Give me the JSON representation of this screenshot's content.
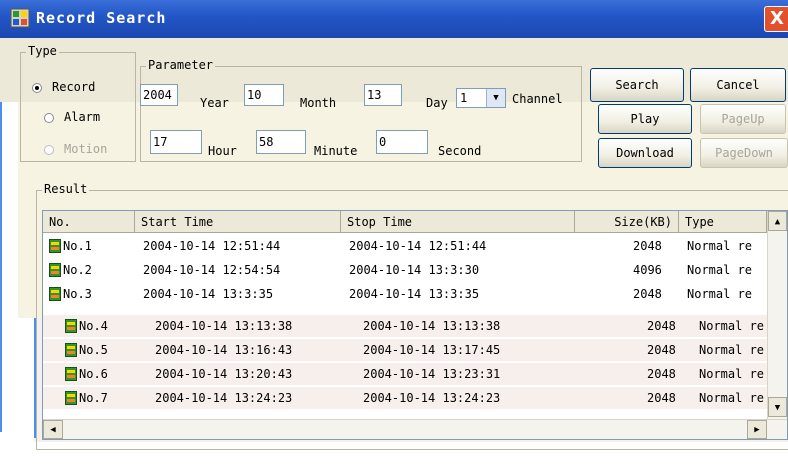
{
  "window": {
    "title": "Record Search",
    "close_glyph": "X"
  },
  "type_group": {
    "legend": "Type",
    "options": [
      {
        "label": "Record",
        "selected": true,
        "enabled": true
      },
      {
        "label": "Alarm",
        "selected": false,
        "enabled": true
      },
      {
        "label": "Motion",
        "selected": false,
        "enabled": false
      }
    ]
  },
  "parameter_group": {
    "legend": "Parameter",
    "year_value": "2004",
    "year_label": "Year",
    "month_value": "10",
    "month_label": "Month",
    "day_value": "13",
    "day_label": "Day",
    "channel_value": "1",
    "channel_label": "Channel",
    "hour_value": "17",
    "hour_label": "Hour",
    "minute_value": "58",
    "minute_label": "Minute",
    "second_value": "0",
    "second_label": "Second"
  },
  "buttons": {
    "search": "Search",
    "cancel": "Cancel",
    "play": "Play",
    "page_up": "PageUp",
    "download": "Download",
    "page_down": "PageDown"
  },
  "result": {
    "legend": "Result",
    "columns": [
      "No.",
      "Start Time",
      "Stop Time",
      "Size(KB)",
      "Type"
    ],
    "rows": [
      {
        "no": "No.1",
        "start": "2004-10-14 12:51:44",
        "stop": "2004-10-14 12:51:44",
        "size": "2048",
        "type": "Normal re"
      },
      {
        "no": "No.2",
        "start": "2004-10-14 12:54:54",
        "stop": "2004-10-14 13:3:30",
        "size": "4096",
        "type": "Normal re"
      },
      {
        "no": "No.3",
        "start": "2004-10-14 13:3:35",
        "stop": "2004-10-14 13:3:35",
        "size": "2048",
        "type": "Normal re"
      },
      {
        "no": "No.4",
        "start": "2004-10-14 13:13:38",
        "stop": "2004-10-14 13:13:38",
        "size": "2048",
        "type": "Normal re"
      },
      {
        "no": "No.5",
        "start": "2004-10-14 13:16:43",
        "stop": "2004-10-14 13:17:45",
        "size": "2048",
        "type": "Normal re"
      },
      {
        "no": "No.6",
        "start": "2004-10-14 13:20:43",
        "stop": "2004-10-14 13:23:31",
        "size": "2048",
        "type": "Normal re"
      },
      {
        "no": "No.7",
        "start": "2004-10-14 13:24:23",
        "stop": "2004-10-14 13:24:23",
        "size": "2048",
        "type": "Normal re"
      }
    ]
  },
  "icons": {
    "close": "close-icon",
    "app": "app-icon",
    "file": "video-file-icon"
  },
  "colors": {
    "titlebar": "#2457c8",
    "close": "#e2512b",
    "panel": "#ece9d8"
  }
}
